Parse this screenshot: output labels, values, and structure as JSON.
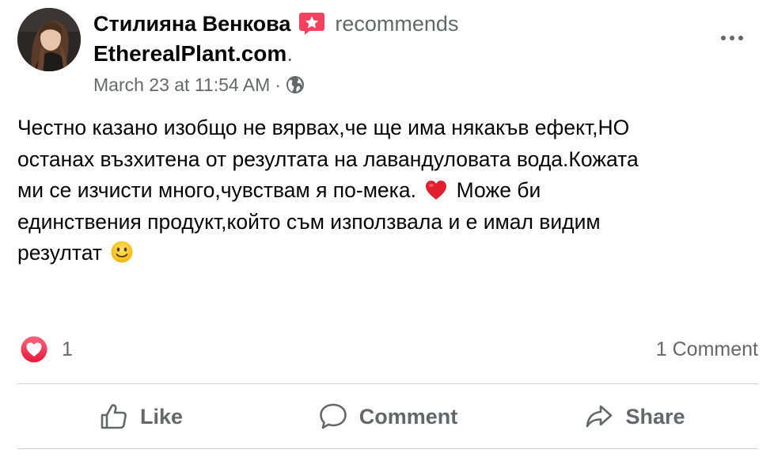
{
  "post": {
    "author": "Стилияна Венкова",
    "recommend_verb": "recommends",
    "page_name": "EtherealPlant.com",
    "page_suffix": ".",
    "timestamp": "March 23 at 11:54 AM",
    "separator": "·",
    "audience_icon": "globe-icon",
    "recommend_icon": "recommendation-star-icon",
    "more_icon": "more-options-icon",
    "body_lines": [
      "Честно казано изобщо не вярвах,че ще има някакъв ефект,НО",
      "останах възхитена от резултата на лавандуловата вода.Кожата",
      "ми се изчисти много,чувствам я по-мека. ",
      " Може би",
      "единствения продукт,който съм използвала и е имал видим",
      "резултат "
    ],
    "body_emojis": [
      "red-heart-emoji",
      "slightly-smiling-face-emoji"
    ]
  },
  "reactions": {
    "icon": "love-reaction-icon",
    "count": "1",
    "comments": "1 Comment"
  },
  "actions": {
    "like": {
      "label": "Like",
      "icon": "thumbs-up-icon"
    },
    "comment": {
      "label": "Comment",
      "icon": "speech-bubble-icon"
    },
    "share": {
      "label": "Share",
      "icon": "share-arrow-icon"
    }
  },
  "colors": {
    "primary_text": "#050505",
    "secondary_text": "#65676b",
    "recommend_badge": "#f3425f",
    "love_reaction": "#f33e58",
    "divider": "#ced0d4"
  }
}
